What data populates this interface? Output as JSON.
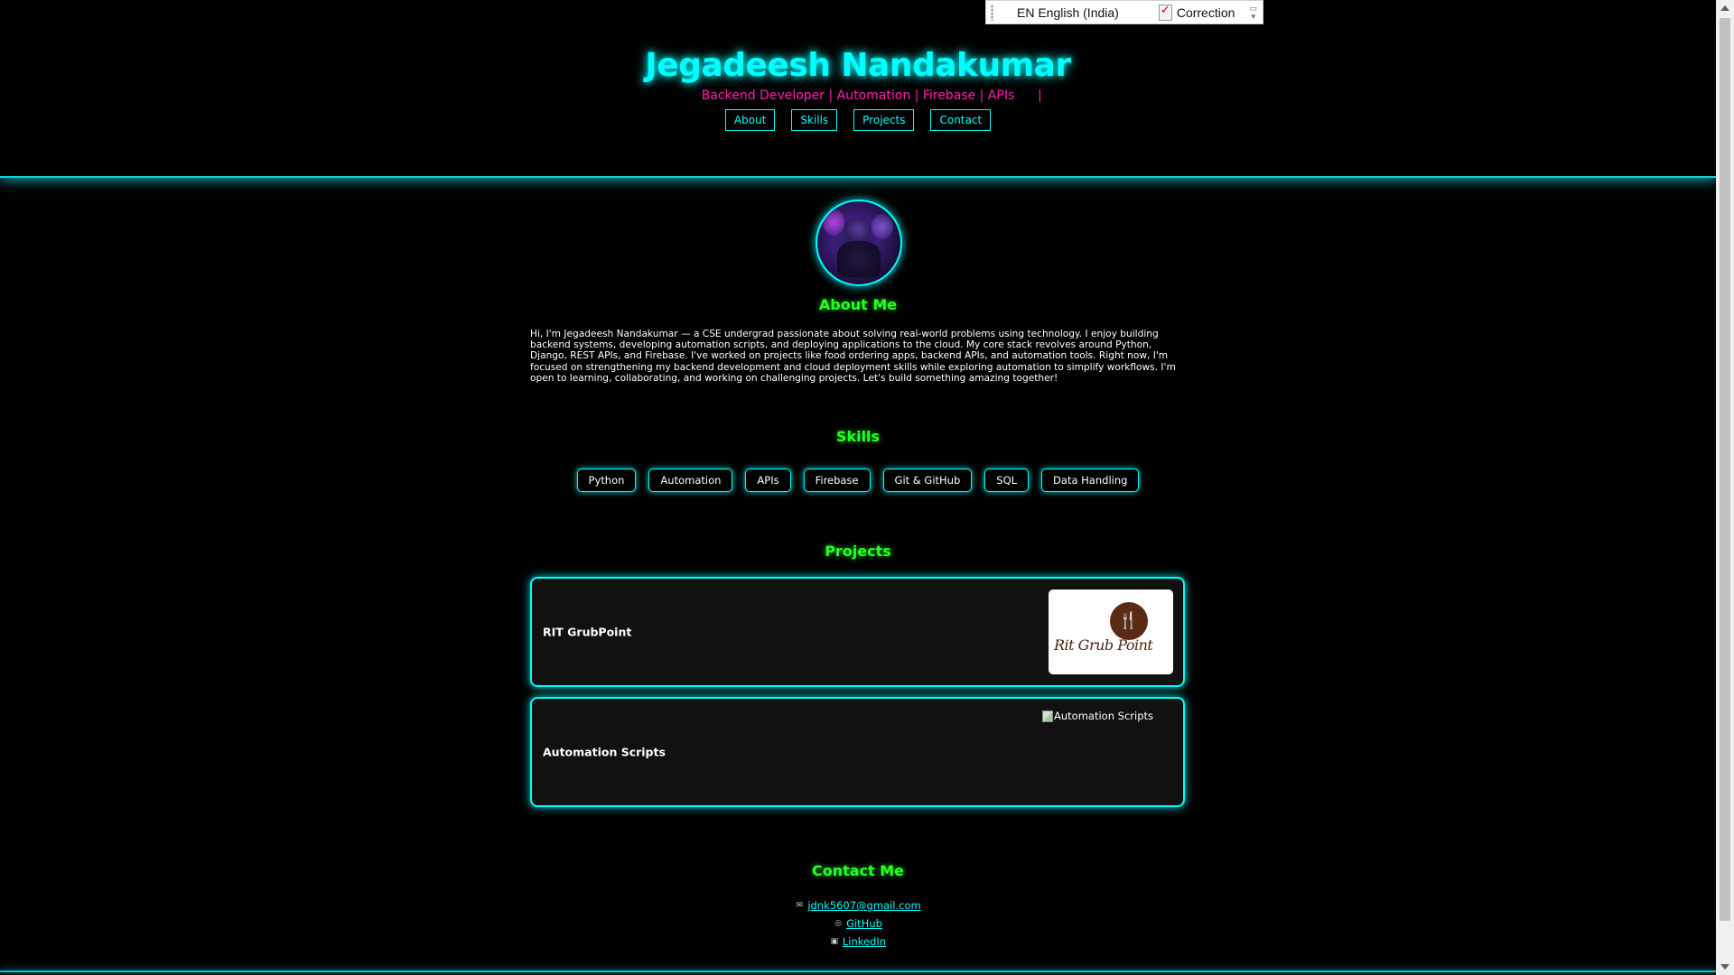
{
  "language_bar": {
    "language": "EN English (India)",
    "correction": "Correction"
  },
  "header": {
    "name": "Jegadeesh Nandakumar",
    "tagline": "Backend Developer | Automation | Firebase | APIs",
    "cursor": "|",
    "nav": [
      "About",
      "Skills",
      "Projects",
      "Contact"
    ]
  },
  "about": {
    "title": "About Me",
    "text": "Hi, I'm Jegadeesh Nandakumar — a CSE undergrad passionate about solving real-world problems using technology. I enjoy building backend systems, developing automation scripts, and deploying applications to the cloud. My core stack revolves around Python, Django, REST APIs, and Firebase. I've worked on projects like food ordering apps, backend APIs, and automation tools. Right now, I'm focused on strengthening my backend development and cloud deployment skills while exploring automation to simplify workflows. I'm open to learning, collaborating, and working on challenging projects. Let's build something amazing together!"
  },
  "skills": {
    "title": "Skills",
    "items": [
      "Python",
      "Automation",
      "APIs",
      "Firebase",
      "Git & GitHub",
      "SQL",
      "Data Handling"
    ]
  },
  "projects": {
    "title": "Projects",
    "items": [
      {
        "name": "RIT GrubPoint",
        "image_text": "Rit Grub Point"
      },
      {
        "name": "Automation Scripts",
        "image_alt": "Automation Scripts"
      }
    ]
  },
  "contact": {
    "title": "Contact Me",
    "email": "jdnk5607@gmail.com",
    "github": "GitHub",
    "linkedin": "LinkedIn"
  },
  "colors": {
    "accent": "#00ffff",
    "heading": "#27ff27",
    "tagline": "#ff1fb4",
    "background": "#000000"
  }
}
